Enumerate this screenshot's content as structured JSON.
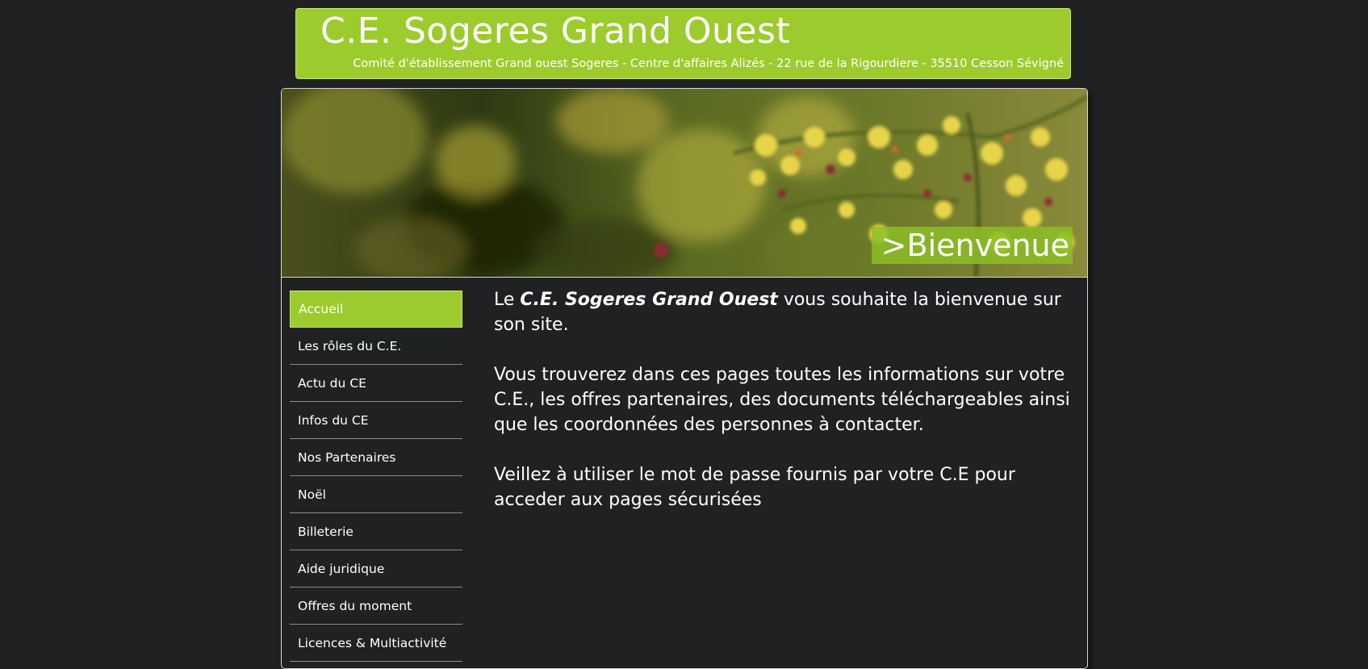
{
  "header": {
    "title": "C.E. Sogeres Grand Ouest",
    "subtitle": "Comité d'établissement Grand ouest Sogeres - Centre d'affaires Alizés - 22 rue de la Rigourdiere - 35510 Cesson Sévigné"
  },
  "banner": {
    "label": ">Bienvenue"
  },
  "nav": {
    "items": [
      {
        "label": "Accueil"
      },
      {
        "label": "Les rôles du C.E."
      },
      {
        "label": "Actu du CE"
      },
      {
        "label": "Infos du CE"
      },
      {
        "label": "Nos Partenaires"
      },
      {
        "label": "Noël"
      },
      {
        "label": "Billeterie"
      },
      {
        "label": "Aide juridique"
      },
      {
        "label": "Offres du moment"
      },
      {
        "label": "Licences & Multiactivité"
      }
    ]
  },
  "content": {
    "intro_prefix": "Le ",
    "intro_name": "C.E. Sogeres Grand Ouest",
    "intro_suffix": " vous souhaite la bienvenue sur son site.",
    "paragraph_2": "Vous trouverez dans ces pages toutes les informations sur votre C.E., les offres partenaires, des documents téléchargeables ainsi que les coordonnées des personnes à contacter.",
    "paragraph_3": "Veillez à utiliser le mot de passe fournis par votre C.E pour acceder aux pages sécurisées"
  },
  "colors": {
    "background": "#202122",
    "accent": "#9ccb2e",
    "text": "#ffffff"
  }
}
